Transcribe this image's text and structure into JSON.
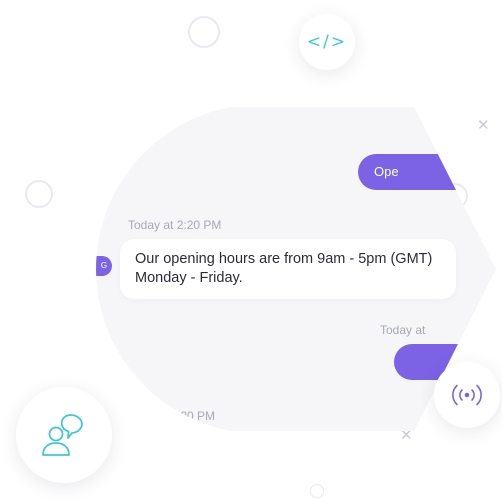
{
  "chat": {
    "sent_partial": "Ope",
    "timestamp_1": "Today at 2:20 PM",
    "message_text": "Our opening hours are from 9am - 5pm (GMT) Monday - Friday.",
    "timestamp_2_partial": "Today at ",
    "timestamp_3_partial": ":20 PM",
    "avatar_partial": "G"
  },
  "icons": {
    "code_glyph": "</>",
    "broadcast": "broadcast-icon",
    "chat_user": "user-chat-icon"
  },
  "colors": {
    "accent": "#7c63e6",
    "teal": "#3fc6d8",
    "background": "#ffffff",
    "panel": "#f6f6f8"
  }
}
